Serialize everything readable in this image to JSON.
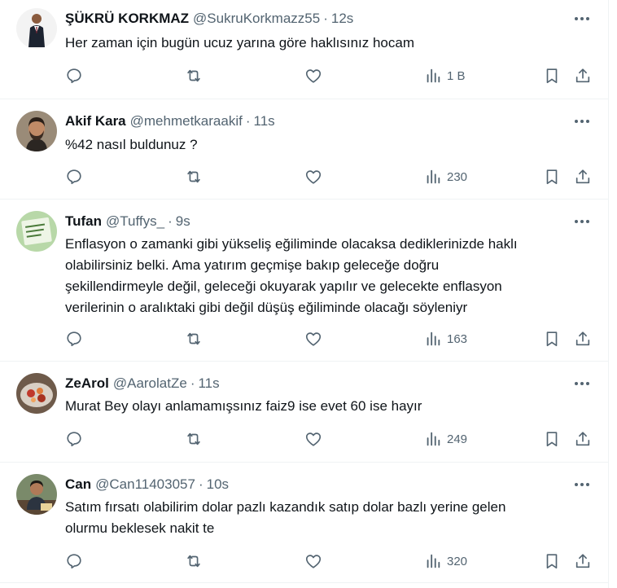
{
  "tweets": [
    {
      "name": "ŞÜKRÜ KORKMAZ",
      "handle": "@SukruKorkmazz55",
      "time": "12s",
      "text": "Her zaman için bugün ucuz yarına göre haklısınız hocam",
      "views": "1 B",
      "avatar_icon": "man-in-suit-avatar"
    },
    {
      "name": "Akif Kara",
      "handle": "@mehmetkaraakif",
      "time": "11s",
      "text": "%42 nasıl buldunuz ?",
      "views": "230",
      "avatar_icon": "bearded-man-avatar"
    },
    {
      "name": "Tufan",
      "handle": "@Tuffys_",
      "time": "9s",
      "text_lines": [
        "Enflasyon o zamanki gibi yükseliş eğiliminde olacaksa dediklerinizde haklı",
        "olabilirsiniz belki. Ama yatırım geçmişe bakıp geleceğe doğru",
        "şekillendirmeyle değil, geleceği okuyarak yapılır ve gelecekte enflasyon",
        "verilerinin o aralıktaki gibi değil düşüş eğiliminde olacağı söyleniyr"
      ],
      "views": "163",
      "avatar_icon": "green-note-avatar"
    },
    {
      "name": "ZeArol",
      "handle": "@AarolatZe",
      "time": "11s",
      "text": "Murat Bey olayı anlamamışsınız faiz9 ise evet 60 ise hayır",
      "views": "249",
      "avatar_icon": "food-plate-avatar"
    },
    {
      "name": "Can",
      "handle": "@Can11403057",
      "time": "10s",
      "text_lines": [
        "Satım fırsatı olabilirim dolar pazlı kazandık satıp dolar bazlı yerine gelen",
        "olurmu beklesek nakit te"
      ],
      "views": "320",
      "avatar_icon": "man-at-desk-avatar"
    }
  ],
  "colors": {
    "text": "#0f1419",
    "secondary": "#536471",
    "divider": "#eff3f4"
  }
}
